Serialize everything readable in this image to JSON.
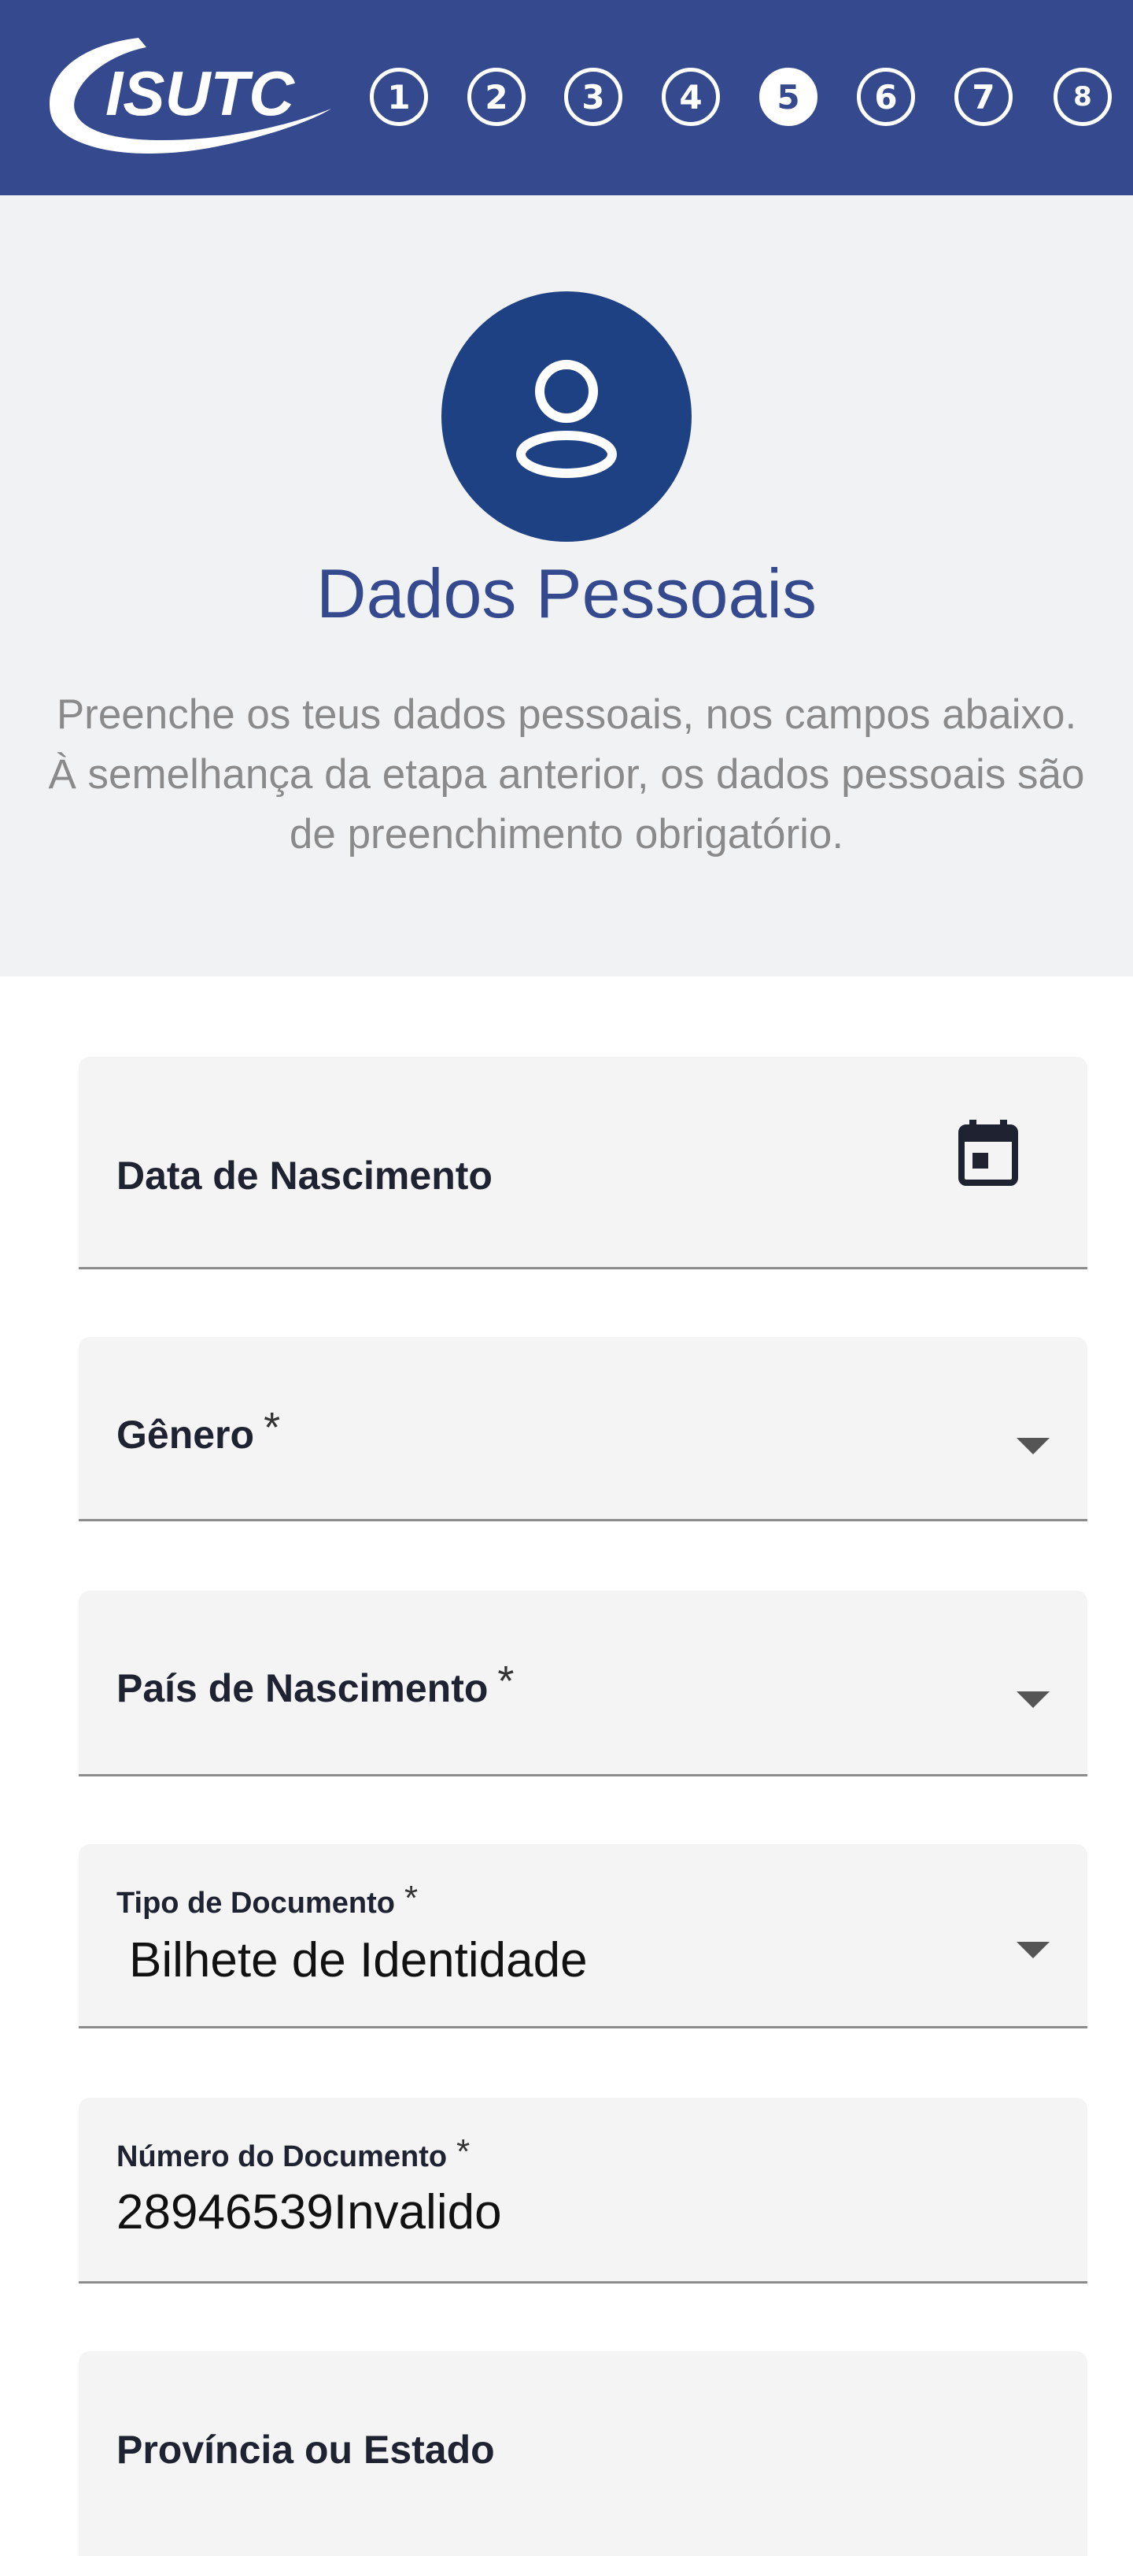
{
  "header": {
    "logo_text": "ISUTC",
    "steps": [
      "1",
      "2",
      "3",
      "4",
      "5",
      "6",
      "7",
      "8"
    ],
    "active_step": "5"
  },
  "intro": {
    "icon": "user-icon",
    "title": "Dados Pessoais",
    "line1": "Preenche os teus dados pessoais, nos campos abaixo.",
    "line2": "À semelhança da etapa anterior, os dados pessoais são de preenchimento obrigatório."
  },
  "form": {
    "birth_date": {
      "label": "Data de Nascimento",
      "icon": "calendar-icon"
    },
    "gender": {
      "label": "Gênero",
      "required": "*",
      "icon": "caret-down-icon"
    },
    "birth_country": {
      "label": "País de Nascimento",
      "required": "*",
      "icon": "caret-down-icon"
    },
    "doc_type": {
      "label": "Tipo de Documento",
      "required": "*",
      "value": "Bilhete de Identidade",
      "icon": "caret-down-icon"
    },
    "doc_number": {
      "label": "Número do Documento",
      "required": "*",
      "value": "28946539Invalido"
    },
    "province": {
      "label": "Província ou Estado"
    }
  },
  "colors": {
    "header_bg": "#34498e",
    "title": "#34498e",
    "avatar_bg": "#1e4183",
    "intro_bg": "#f1f2f4",
    "field_bg": "#f4f4f4"
  }
}
